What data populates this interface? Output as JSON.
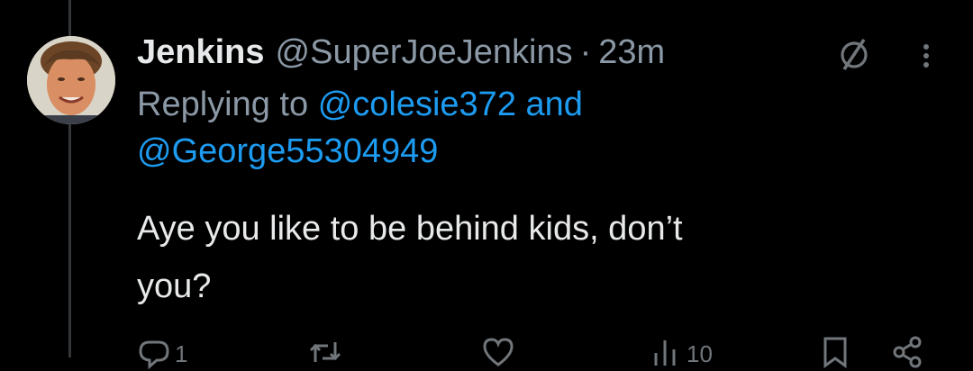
{
  "tweet": {
    "display_name": "Jenkins",
    "handle": "@SuperJoeJenkins",
    "separator": "·",
    "time": "23m",
    "replying_prefix": "Replying to",
    "mention_1": "@colesie372",
    "and_text": "and",
    "mention_2": "@George55304949",
    "body_line_1": "Aye you like to be behind kids, don’t",
    "body_line_2": "you?"
  },
  "actions": {
    "reply_count": "1",
    "views_count": "10"
  },
  "colors": {
    "background": "#000000",
    "text": "#e7e9ea",
    "secondary": "#8b98a5",
    "link": "#1d9bf0",
    "thread_line": "#333639"
  },
  "icons": [
    "grok-icon",
    "more-icon",
    "reply-icon",
    "retweet-icon",
    "like-icon",
    "views-icon",
    "bookmark-icon",
    "share-icon"
  ]
}
